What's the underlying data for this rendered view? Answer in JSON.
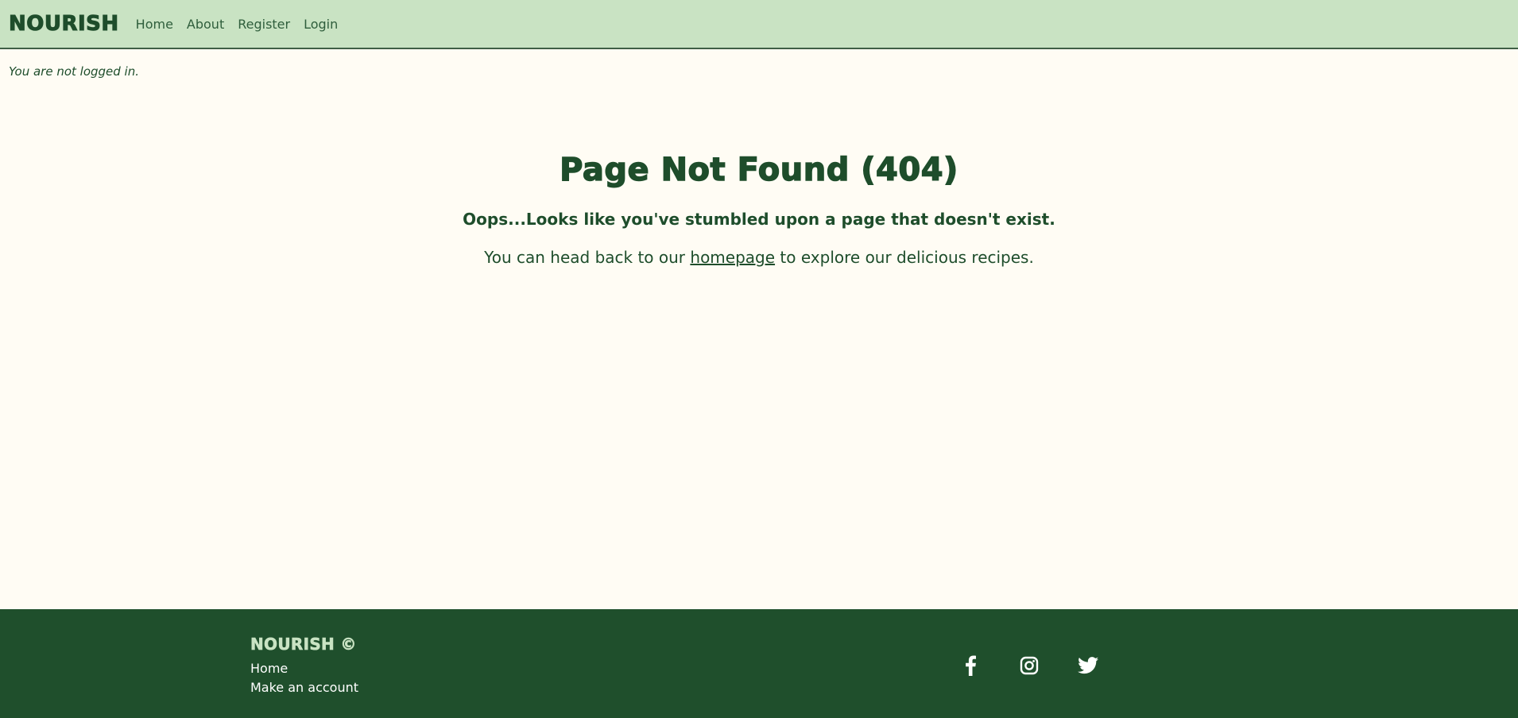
{
  "navbar": {
    "brand": "NOURISH",
    "links": [
      "Home",
      "About",
      "Register",
      "Login"
    ]
  },
  "status": {
    "login_text": "You are not logged in."
  },
  "main": {
    "title": "Page Not Found (404)",
    "subtitle": "Oops...Looks like you've stumbled upon a page that doesn't exist.",
    "body_before": "You can head back to our ",
    "body_link": "homepage",
    "body_after": " to explore our delicious recipes."
  },
  "footer": {
    "brand": "NOURISH ©",
    "links": [
      "Home",
      "Make an account"
    ],
    "socials": [
      "facebook-icon",
      "instagram-icon",
      "twitter-icon"
    ]
  },
  "colors": {
    "navbar_bg": "#c9e3c3",
    "page_bg": "#fffcf4",
    "primary_text": "#1e4d2b",
    "footer_bg": "#1f4f2c",
    "footer_brand": "#c9e3c3"
  }
}
